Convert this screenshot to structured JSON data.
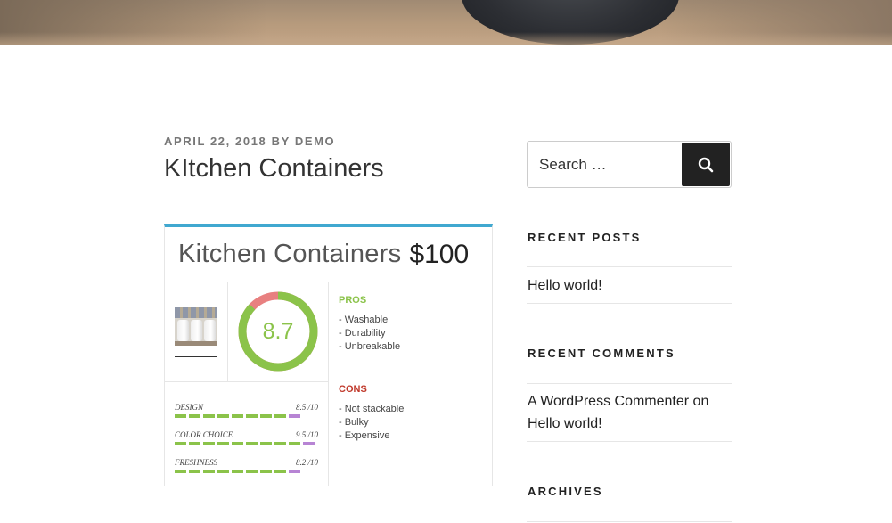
{
  "header": {
    "image_alt": "header-image"
  },
  "post": {
    "date": "April 22, 2018",
    "by": "by",
    "author": "Demo",
    "title": "KItchen Containers"
  },
  "review": {
    "name": "Kitchen Containers",
    "price": "$100",
    "score": "8.7",
    "score_value": 8.7,
    "score_max": 10,
    "criteria": [
      {
        "label": "Design",
        "score": "8.5 /10",
        "value": 8.5
      },
      {
        "label": "Color Choice",
        "score": "9.5 /10",
        "value": 9.5
      },
      {
        "label": "Freshness",
        "score": "8.2 /10",
        "value": 8.2
      }
    ],
    "pros_title": "PROS",
    "pros": [
      "- Washable",
      "- Durability",
      "- Unbreakable"
    ],
    "cons_title": "CONS",
    "cons": [
      "- Not stackable",
      "- Bulky",
      "- Expensive"
    ],
    "colors": {
      "accent": "#40a8d0",
      "good": "#8bc34a",
      "bad": "#e88080",
      "partial": "#b784d4",
      "cons": "#c0392b"
    }
  },
  "sidebar": {
    "search_placeholder": "Search …",
    "search_icon": "search-icon",
    "recent_posts_title": "Recent Posts",
    "recent_posts": [
      "Hello world!"
    ],
    "recent_comments_title": "Recent Comments",
    "comment_author": "A WordPress Commenter",
    "comment_on": "on",
    "comment_post": "Hello world!",
    "archives_title": "Archives"
  }
}
